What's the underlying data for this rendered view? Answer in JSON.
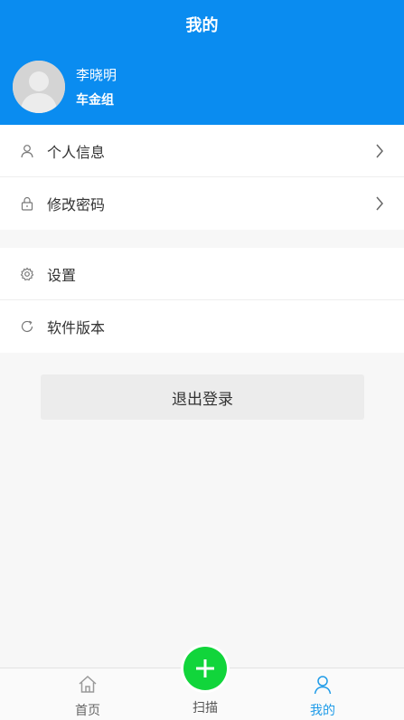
{
  "header": {
    "title": "我的"
  },
  "user": {
    "name": "李晓明",
    "group": "车金组"
  },
  "menu": {
    "group1": [
      {
        "label": "个人信息",
        "icon": "user-icon"
      },
      {
        "label": "修改密码",
        "icon": "lock-icon"
      }
    ],
    "group2": [
      {
        "label": "设置",
        "icon": "gear-icon"
      },
      {
        "label": "软件版本",
        "icon": "refresh-icon"
      }
    ]
  },
  "logout_label": "退出登录",
  "tabbar": {
    "home": "首页",
    "scan": "扫描",
    "me": "我的"
  },
  "colors": {
    "primary": "#0a8cf0",
    "scan": "#11d53b",
    "active_tab": "#1e9be8"
  }
}
